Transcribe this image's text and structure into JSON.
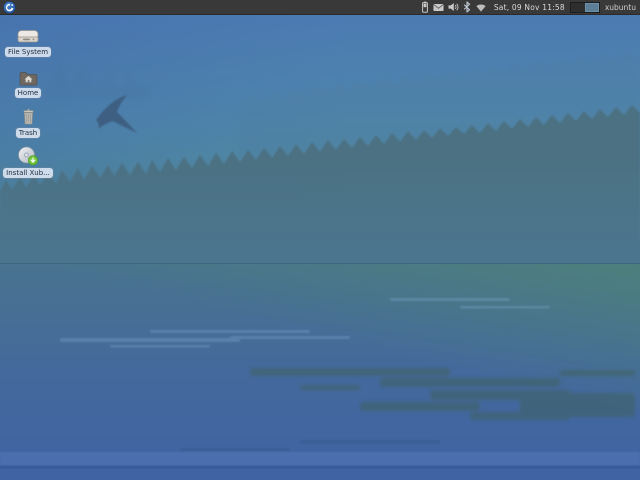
{
  "panel": {
    "logo_icon": "xubuntu-menu-icon",
    "tray": {
      "battery": "battery-icon",
      "mail": "mail-icon",
      "volume": "volume-icon",
      "bluetooth": "bluetooth-icon",
      "network": "network-wifi-icon"
    },
    "clock": "Sat, 09 Nov 11:58",
    "workspaces": {
      "count": 2,
      "active": 2
    },
    "user_label": "xubuntu"
  },
  "desktop": {
    "icons": [
      {
        "id": "file-system",
        "icon": "drive-icon",
        "label": "File System"
      },
      {
        "id": "home",
        "icon": "home-folder-icon",
        "label": "Home"
      },
      {
        "id": "trash",
        "icon": "trash-icon",
        "label": "Trash"
      },
      {
        "id": "install-xubuntu",
        "icon": "install-disc-icon",
        "label": "Install Xub..."
      }
    ]
  },
  "colors": {
    "panel_bg": "#393939",
    "panel_text": "#dadada",
    "label_bg": "#d9e3f0",
    "label_text": "#1d2b3a",
    "sky_top": "#4b79b4",
    "sky_teal": "#53908c",
    "treeline": "#4b7080",
    "water_top": "#49738f",
    "water_bottom": "#3f63a3",
    "logo_blue": "#2d62a9",
    "workspace_active": "#5d7e99"
  }
}
